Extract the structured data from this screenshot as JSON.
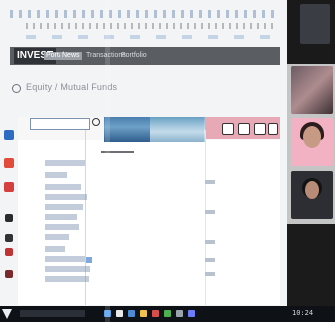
{
  "app": {
    "brand": "INVEST",
    "nav": [
      "Portal",
      "News",
      "Transactions",
      "Portfolio"
    ]
  },
  "page": {
    "title": "Equity / Mutual Funds"
  },
  "taskbar": {
    "clock": "10:24"
  },
  "colors": {
    "appbar": "#5a5e63",
    "ribbon": "#e8a9b6",
    "taskbar": "#0e1116"
  }
}
